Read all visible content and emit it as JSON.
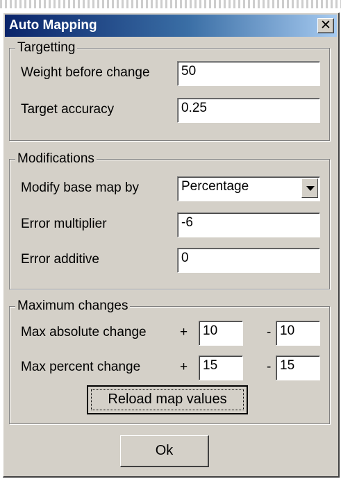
{
  "window": {
    "title": "Auto Mapping"
  },
  "targetting": {
    "group_title": "Targetting",
    "weight_label": "Weight before change",
    "weight_value": "50",
    "accuracy_label": "Target accuracy",
    "accuracy_value": "0.25"
  },
  "modifications": {
    "group_title": "Modifications",
    "modify_label": "Modify base map by",
    "modify_selected": "Percentage",
    "error_multiplier_label": "Error multiplier",
    "error_multiplier_value": "-6",
    "error_additive_label": "Error additive",
    "error_additive_value": "0"
  },
  "max_changes": {
    "group_title": "Maximum changes",
    "abs_label": "Max absolute change",
    "abs_plus_sign": "+",
    "abs_plus_value": "10",
    "abs_minus_sign": "-",
    "abs_minus_value": "10",
    "pct_label": "Max percent change",
    "pct_plus_sign": "+",
    "pct_plus_value": "15",
    "pct_minus_sign": "-",
    "pct_minus_value": "15",
    "reload_label": "Reload map values"
  },
  "footer": {
    "ok_label": "Ok"
  },
  "colors": {
    "title_bar_start": "#0a246a",
    "title_bar_end": "#a6caf0",
    "dialog_face": "#d4d0c8"
  },
  "icons": {
    "close": "close-icon",
    "dropdown": "chevron-down-icon"
  }
}
